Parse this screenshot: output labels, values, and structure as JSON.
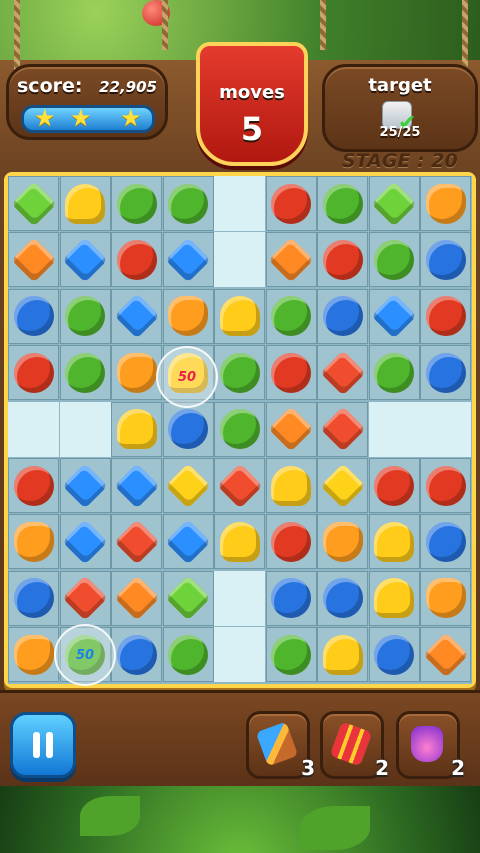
{
  "hud": {
    "score_label": "score:",
    "score_value": "22,905",
    "stars_earned": 3,
    "moves_label": "moves",
    "moves_value": "5",
    "target_label": "target",
    "target_progress": "25/25",
    "target_icon": "gray-block-icon",
    "stage_label": "STAGE : 20"
  },
  "board": {
    "columns": 9,
    "rows": 9,
    "pieces": [
      [
        "green-gem",
        "mushroom",
        "melon",
        "melon",
        "",
        "tomato",
        "melon",
        "green-gem",
        "carrot"
      ],
      [
        "orange-gem",
        "blue-gem",
        "tomato",
        "blue-gem",
        "",
        "orange-gem",
        "tomato",
        "melon",
        "blueberry"
      ],
      [
        "blueberry",
        "melon",
        "blue-gem",
        "carrot",
        "mushroom",
        "melon",
        "blueberry",
        "blue-gem",
        "tomato"
      ],
      [
        "tomato",
        "melon",
        "carrot",
        "mushroom",
        "melon",
        "tomato",
        "red-gem",
        "melon",
        "blueberry"
      ],
      [
        "",
        "",
        "mushroom",
        "blueberry",
        "melon",
        "orange-gem",
        "red-gem",
        "",
        ""
      ],
      [
        "tomato",
        "blue-gem",
        "blue-gem",
        "yellow-gem",
        "red-gem",
        "mushroom",
        "yellow-gem",
        "tomato",
        "tomato"
      ],
      [
        "carrot",
        "blue-gem",
        "red-gem",
        "blue-gem",
        "mushroom",
        "tomato",
        "carrot",
        "mushroom",
        "blueberry"
      ],
      [
        "blueberry",
        "red-gem",
        "orange-gem",
        "green-gem",
        "",
        "blueberry",
        "blueberry",
        "mushroom",
        "carrot"
      ],
      [
        "carrot",
        "melon",
        "blueberry",
        "melon",
        "",
        "melon",
        "mushroom",
        "blueberry",
        "orange-gem"
      ]
    ],
    "bonus_bubbles": [
      {
        "text": "50"
      },
      {
        "text": "50"
      }
    ]
  },
  "boosters": [
    {
      "name": "hammer",
      "count": "3"
    },
    {
      "name": "firework",
      "count": "2"
    },
    {
      "name": "potion",
      "count": "2"
    }
  ],
  "colors": {
    "board_frame": "#ffd54a",
    "moves_banner": "#e43b2e",
    "pause_button": "#1f8fe6"
  }
}
